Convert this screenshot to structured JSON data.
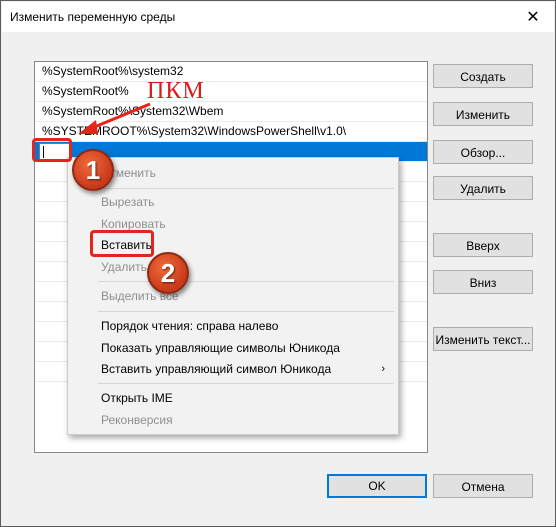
{
  "window": {
    "title": "Изменить переменную среды",
    "close_glyph": "✕"
  },
  "list": {
    "items": [
      "%SystemRoot%\\system32",
      "%SystemRoot%",
      "%SystemRoot%\\System32\\Wbem",
      "%SYSTEMROOT%\\System32\\WindowsPowerShell\\v1.0\\"
    ],
    "editing_value": ""
  },
  "buttons": {
    "create": "Создать",
    "edit": "Изменить",
    "browse": "Обзор...",
    "delete": "Удалить",
    "up": "Вверх",
    "down": "Вниз",
    "edit_text": "Изменить текст...",
    "ok": "OK",
    "cancel": "Отмена"
  },
  "context_menu": {
    "undo": "Отменить",
    "cut": "Вырезать",
    "copy": "Копировать",
    "paste": "Вставить",
    "delete": "Удалить",
    "select_all": "Выделить все",
    "rtl_order": "Порядок чтения: справа налево",
    "show_unicode": "Показать управляющие символы Юникода",
    "insert_unicode": "Вставить управляющий символ Юникода",
    "open_ime": "Открыть IME",
    "reconversion": "Реконверсия",
    "submenu_arrow": "›"
  },
  "annotations": {
    "label": "ПКМ",
    "badge1": "1",
    "badge2": "2",
    "color": "#e5241b"
  }
}
